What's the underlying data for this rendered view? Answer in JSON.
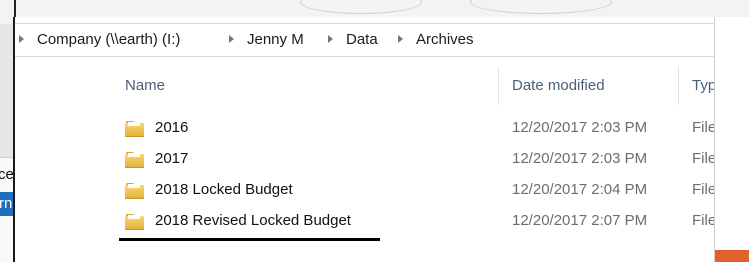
{
  "breadcrumb": {
    "items": [
      "Company (\\\\earth) (I:)",
      "Jenny M",
      "Data",
      "Archives"
    ]
  },
  "columns": {
    "name": "Name",
    "date_modified": "Date modified",
    "type": "Type"
  },
  "rows": [
    {
      "name": "2016",
      "date": "12/20/2017 2:03 PM",
      "type": "File folder"
    },
    {
      "name": "2017",
      "date": "12/20/2017 2:03 PM",
      "type": "File folder"
    },
    {
      "name": "2018 Locked Budget",
      "date": "12/20/2017 2:04 PM",
      "type": "File folder"
    },
    {
      "name": "2018 Revised Locked Budget",
      "date": "12/20/2017 2:07 PM",
      "type": "File folder"
    }
  ],
  "background_window": {
    "partial_text_1": "ce",
    "partial_text_2": "rn"
  },
  "colors": {
    "folder": "#f2c94c",
    "selection": "#1f6fbf",
    "header_text": "#4a5f7a",
    "orange_accent": "#e0622a",
    "underline": "#000000"
  },
  "icons": {
    "folder": "folder-icon",
    "breadcrumb_separator": "chevron-right-icon"
  }
}
